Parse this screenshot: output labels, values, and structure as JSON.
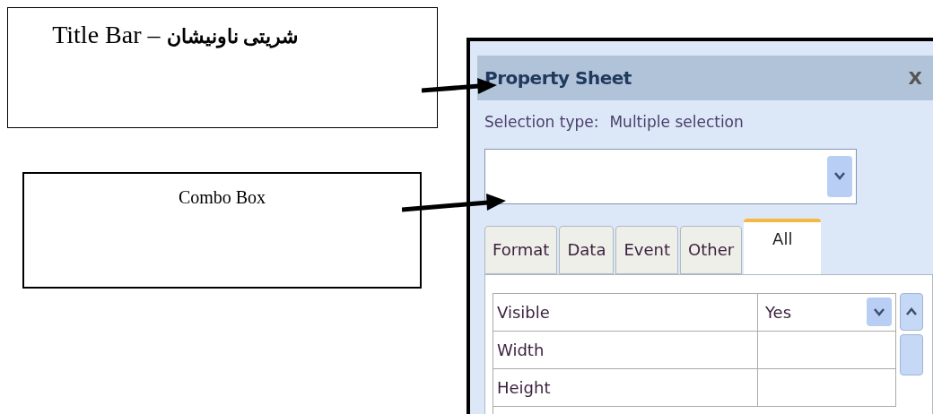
{
  "callouts": [
    {
      "label": "Title Bar",
      "label_local": "شریتی ناونیشان",
      "separator": "–"
    },
    {
      "label": "Combo Box"
    }
  ],
  "panel": {
    "title": "Property Sheet",
    "close": "X",
    "selection_label": "Selection type:",
    "selection_value": "Multiple selection",
    "tabs": [
      {
        "label": "Format",
        "selected": false
      },
      {
        "label": "Data",
        "selected": false
      },
      {
        "label": "Event",
        "selected": false
      },
      {
        "label": "Other",
        "selected": false
      },
      {
        "label": "All",
        "selected": true
      }
    ],
    "properties": [
      {
        "name": "Visible",
        "value": "Yes",
        "has_dropdown": true
      },
      {
        "name": "Width",
        "has_dropdown": false
      },
      {
        "name": "Height",
        "has_dropdown": false
      }
    ]
  }
}
